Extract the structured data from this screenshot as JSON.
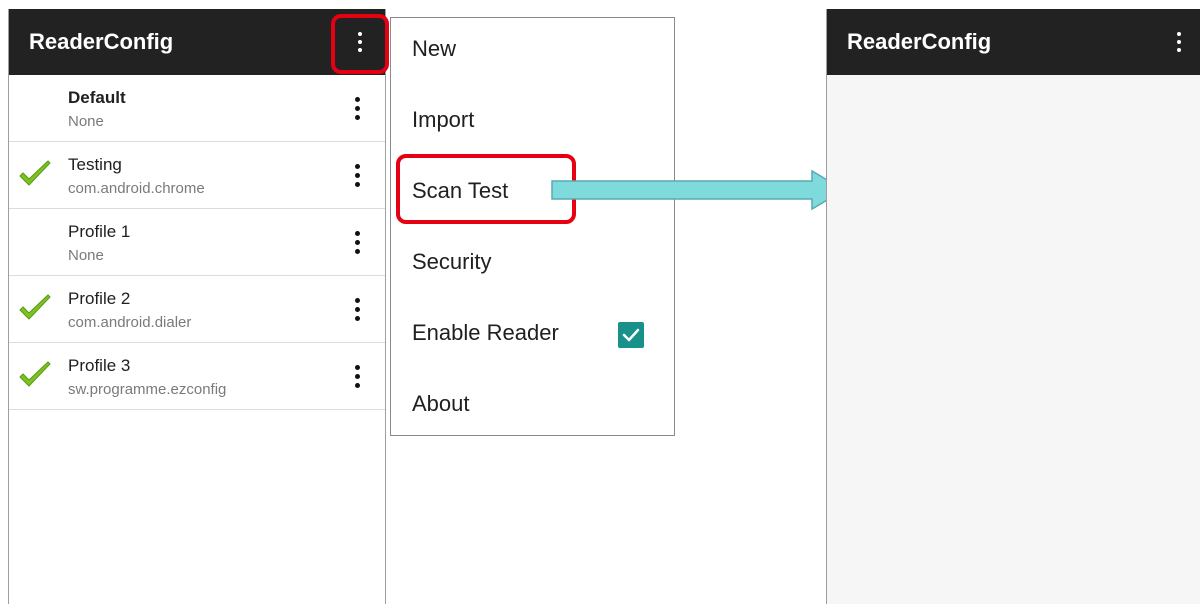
{
  "app": {
    "title": "ReaderConfig"
  },
  "profiles": [
    {
      "name": "Default",
      "sub": "None",
      "bold": true,
      "checked": false
    },
    {
      "name": "Testing",
      "sub": "com.android.chrome",
      "bold": false,
      "checked": true
    },
    {
      "name": "Profile 1",
      "sub": "None",
      "bold": false,
      "checked": false
    },
    {
      "name": "Profile 2",
      "sub": "com.android.dialer",
      "bold": false,
      "checked": true
    },
    {
      "name": "Profile 3",
      "sub": "sw.programme.ezconfig",
      "bold": false,
      "checked": true
    }
  ],
  "menu": {
    "items": [
      "New",
      "Import",
      "Scan Test",
      "Security",
      "Enable Reader",
      "About"
    ],
    "enable_reader_checked": true
  },
  "right_panel": {
    "title": "ReaderConfig"
  },
  "colors": {
    "appbar": "#222222",
    "highlight": "#e50012",
    "checkbox": "#17918a",
    "arrow": "#7fdbdb",
    "checkmark": "#7cc322"
  }
}
